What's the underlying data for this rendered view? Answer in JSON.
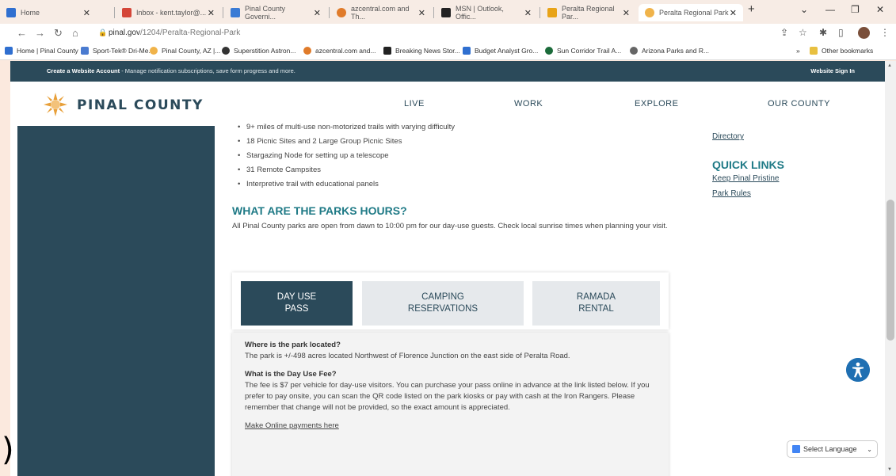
{
  "browser": {
    "tabs": [
      {
        "label": "Home",
        "color": "#2f6fd0"
      },
      {
        "label": "Inbox - kent.taylor@...",
        "color": "#d44638"
      },
      {
        "label": "Pinal County Governi...",
        "color": "#3a7bd5"
      },
      {
        "label": "azcentral.com and Th...",
        "color": "#e07b2a"
      },
      {
        "label": "MSN | Outlook, Offic...",
        "color": "#222222"
      },
      {
        "label": "Peralta Regional Par...",
        "color": "#e8a317"
      },
      {
        "label": "Peralta Regional Park",
        "color": "#f0b34a"
      }
    ],
    "new_tab": "+",
    "url_host": "pinal.gov",
    "url_path": "/1204/Peralta-Regional-Park",
    "bookmarks": [
      {
        "label": "Home | Pinal County",
        "color": "#2f6fd0"
      },
      {
        "label": "Sport-Tek® Dri-Me...",
        "color": "#4a7bd0"
      },
      {
        "label": "Pinal County, AZ |...",
        "color": "#f0b34a"
      },
      {
        "label": "Superstition Astron...",
        "color": "#333333"
      },
      {
        "label": "azcentral.com and...",
        "color": "#e07b2a"
      },
      {
        "label": "Breaking News Stor...",
        "color": "#222222"
      },
      {
        "label": "Budget Analyst Gro...",
        "color": "#2f6fd0"
      },
      {
        "label": "Sun Corridor Trail A...",
        "color": "#1b6b3a"
      },
      {
        "label": "Arizona Parks and R...",
        "color": "#666666"
      },
      {
        "label": "»",
        "color": "#ffffff"
      },
      {
        "label": "Other bookmarks",
        "color": "#e8c040"
      }
    ]
  },
  "site": {
    "top_band_bold": "Create a Website Account",
    "top_band_text": " - Manage notification subscriptions, save form progress and more.",
    "sign_in": "Website Sign In",
    "logo_text": "PINAL COUNTY",
    "nav": [
      "LIVE",
      "WORK",
      "EXPLORE",
      "OUR COUNTY"
    ],
    "brand_color": "#2b4a5a",
    "accent_color": "#1f7a86"
  },
  "main": {
    "bullets": [
      "9+ miles of multi-use non-motorized trails with varying difficulty",
      "18 Picnic Sites and 2 Large Group Picnic Sites",
      "Stargazing Node for setting up a telescope",
      "31 Remote Campsites",
      "Interpretive trail with educational panels"
    ],
    "hours_heading": "WHAT ARE THE PARKS HOURS?",
    "hours_text": "All Pinal County parks are open from dawn to 10:00 pm for our day-use guests. Check local sunrise times when planning your visit.",
    "tabs": [
      {
        "line1": "DAY USE",
        "line2": "PASS"
      },
      {
        "line1": "CAMPING",
        "line2": "RESERVATIONS"
      },
      {
        "line1": "RAMADA",
        "line2": "RENTAL"
      }
    ],
    "faq": [
      {
        "q": "Where is the park located?",
        "a": "The park is +/-498 acres located Northwest of Florence Junction on the east side of Peralta Road."
      },
      {
        "q": "What is the Day Use Fee?",
        "a": "The fee is $7 per vehicle for day-use visitors.  You can purchase your pass online in advance at the link listed below. If you prefer to pay onsite, you can scan the QR code listed on the park kiosks or pay with cash at the Iron Rangers.  Please remember that change will not be provided, so the exact amount is appreciated."
      }
    ],
    "payment_link": "Make Online payments here"
  },
  "right": {
    "directory": "Directory",
    "quick_links_heading": "QUICK LINKS",
    "links": [
      "Keep Pinal Pristine",
      "Park Rules"
    ]
  },
  "widgets": {
    "language": "Select Language"
  },
  "overlay": {
    "paren": ")"
  }
}
